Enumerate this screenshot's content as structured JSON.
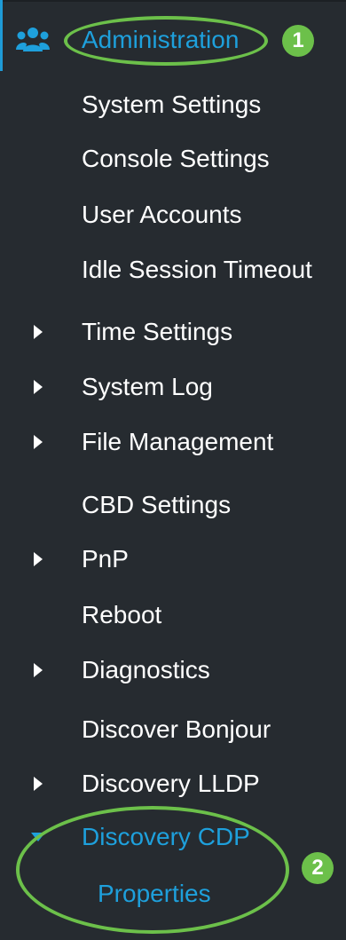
{
  "menu": {
    "section_title": "Administration",
    "items": [
      {
        "label": "System Settings"
      },
      {
        "label": "Console Settings"
      },
      {
        "label": "User Accounts"
      },
      {
        "label": "Idle Session Timeout"
      },
      {
        "label": "Time Settings",
        "expandable": true
      },
      {
        "label": "System Log",
        "expandable": true
      },
      {
        "label": "File Management",
        "expandable": true
      },
      {
        "label": "CBD Settings"
      },
      {
        "label": "PnP",
        "expandable": true
      },
      {
        "label": "Reboot"
      },
      {
        "label": "Diagnostics",
        "expandable": true
      },
      {
        "label": "Discover Bonjour"
      },
      {
        "label": "Discovery LLDP",
        "expandable": true
      },
      {
        "label": "Discovery CDP",
        "expanded": true
      },
      {
        "label": "Properties"
      }
    ]
  },
  "callouts": {
    "first": "1",
    "second": "2"
  },
  "colors": {
    "background": "#262b30",
    "accent": "#1ea0dc",
    "callout": "#6cc04a",
    "text": "#ffffff"
  },
  "icons": {
    "section": "users-icon",
    "collapsed": "caret-right-icon",
    "expanded": "caret-down-icon"
  }
}
